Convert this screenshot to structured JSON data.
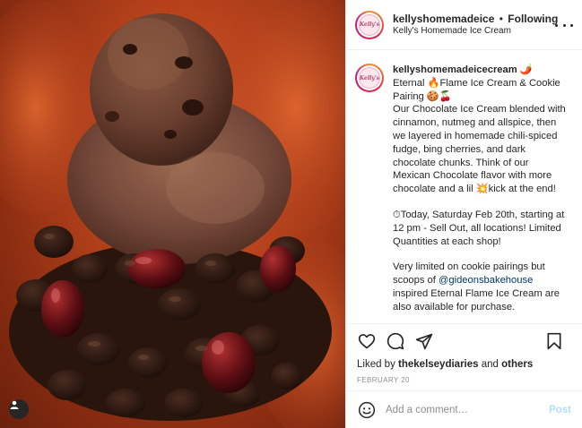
{
  "post": {
    "username": "kellyshomemadeice",
    "separator": "•",
    "following_label": "Following",
    "subtitle": "Kelly's Homemade Ice Cream",
    "avatar_text": "Kelly's",
    "caption": {
      "username": "kellyshomemadeicecream",
      "username_emoji": "🌶️",
      "line1": "Eternal 🔥Flame Ice Cream & Cookie Pairing 🍪🍒",
      "line2": "Our Chocolate Ice Cream blended with cinnamon, nutmeg and allspice, then we layered in homemade chili-spiced fudge, bing cherries, and dark chocolate chunks. Think of our Mexican Chocolate flavor with more chocolate and a lil 💥kick at the end!",
      "para2": "⏱Today, Saturday Feb 20th, starting at 12 pm - Sell Out, all locations! Limited Quantities at each shop!",
      "para3_before": "Very limited on cookie pairings but scoops of ",
      "para3_mention": "@gideonsbakehouse",
      "para3_after": " inspired Eternal Flame Ice Cream are also available for purchase."
    },
    "likes_prefix": "Liked by ",
    "likes_user": "thekelseydiaries",
    "likes_and": " and ",
    "likes_others": "others",
    "date": "FEBRUARY 20",
    "comment_placeholder": "Add a comment…",
    "post_label": "Post"
  },
  "icons": {
    "more": "more-options-icon",
    "like": "heart-icon",
    "comment": "comment-icon",
    "share": "share-icon",
    "save": "bookmark-icon",
    "emoji": "emoji-icon",
    "user_tag": "user-tag-icon"
  },
  "colors": {
    "link": "#00376b",
    "post_disabled": "#b2dffc",
    "muted": "#8e8e8e"
  }
}
